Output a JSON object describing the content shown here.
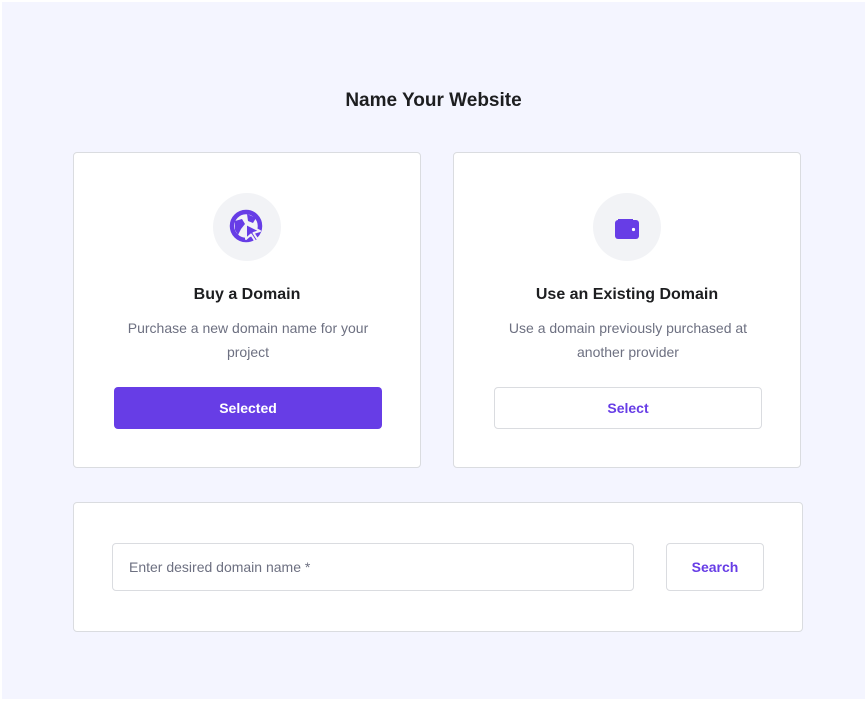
{
  "page": {
    "title": "Name Your Website"
  },
  "options": [
    {
      "icon": "globe-cursor-icon",
      "title": "Buy a Domain",
      "description": "Purchase a new domain name for your project",
      "button_label": "Selected",
      "selected": true
    },
    {
      "icon": "wallet-icon",
      "title": "Use an Existing Domain",
      "description": "Use a domain previously purchased at another provider",
      "button_label": "Select",
      "selected": false
    }
  ],
  "search": {
    "placeholder": "Enter desired domain name *",
    "value": "",
    "button_label": "Search"
  },
  "colors": {
    "accent": "#673de6",
    "background": "#f4f5ff",
    "border": "#dadce0",
    "text_primary": "#1d1e20",
    "text_secondary": "#6d7081"
  }
}
